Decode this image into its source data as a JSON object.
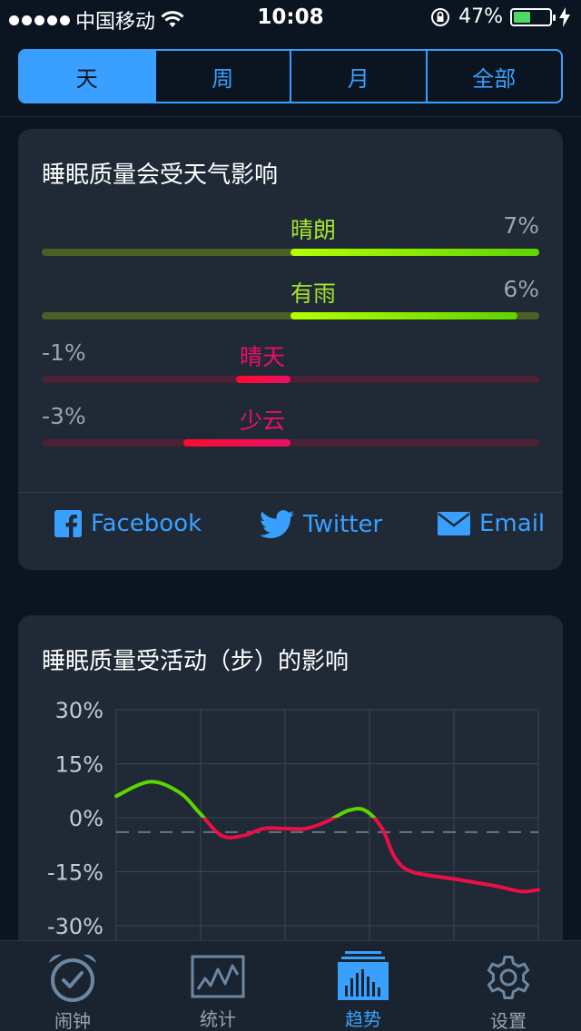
{
  "status_bar": {
    "carrier": "中国移动",
    "time": "10:08",
    "battery_text": "47%",
    "battery_level": 0.47
  },
  "segments": [
    {
      "label": "天",
      "active": true
    },
    {
      "label": "周",
      "active": false
    },
    {
      "label": "月",
      "active": false
    },
    {
      "label": "全部",
      "active": false
    }
  ],
  "weather_card": {
    "title": "睡眠质量会受天气影响",
    "rows": [
      {
        "label": "晴朗",
        "value_text": "7%",
        "value": 7,
        "positive": true
      },
      {
        "label": "有雨",
        "value_text": "6%",
        "value": 6,
        "positive": true
      },
      {
        "label": "晴天",
        "value_text": "-1%",
        "value": -1,
        "positive": false
      },
      {
        "label": "少云",
        "value_text": "-3%",
        "value": -3,
        "positive": false
      }
    ],
    "share": {
      "facebook": "Facebook",
      "twitter": "Twitter",
      "email": "Email"
    }
  },
  "activity_card": {
    "title": "睡眠质量受活动（步）的影响"
  },
  "chart_data": {
    "type": "line",
    "title": "睡眠质量受活动（步）的影响",
    "xlabel": "",
    "ylabel": "",
    "yticks": [
      "30%",
      "15%",
      "0%",
      "-15%",
      "-30%"
    ],
    "ylim": [
      -30,
      30
    ],
    "xlim": [
      0,
      10
    ],
    "grid": true,
    "baseline": -4,
    "series": [
      {
        "x": [
          0,
          0.8,
          1.5,
          2.0,
          2.5,
          3.0,
          3.5,
          4.0,
          4.5,
          5.0,
          5.5,
          5.9,
          6.3,
          6.6,
          7.0,
          8.0,
          9.0,
          9.6,
          10.0
        ],
        "y": [
          6,
          10,
          7,
          1,
          -5,
          -5,
          -3,
          -3,
          -3,
          -1,
          2,
          2,
          -3,
          -11,
          -15,
          -17,
          -19,
          -20.5,
          -20
        ]
      }
    ],
    "colors": {
      "above": "#5ed400",
      "below": "#ec0f47"
    }
  },
  "tab_bar": [
    {
      "label": "闹钟",
      "icon": "alarm-clock-icon",
      "active": false
    },
    {
      "label": "统计",
      "icon": "statistics-icon",
      "active": false
    },
    {
      "label": "趋势",
      "icon": "trends-icon",
      "active": true
    },
    {
      "label": "设置",
      "icon": "settings-gear-icon",
      "active": false
    }
  ]
}
